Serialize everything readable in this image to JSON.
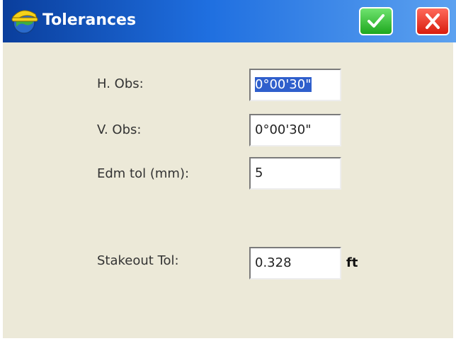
{
  "window": {
    "title": "Tolerances",
    "icon": "hard-hat-globe-icon",
    "ok_icon": "checkmark-icon",
    "cancel_icon": "close-x-icon"
  },
  "fields": {
    "h_obs": {
      "label": "H. Obs:",
      "value": "0°00'30\""
    },
    "v_obs": {
      "label": "V. Obs:",
      "value": "0°00'30\""
    },
    "edm_tol": {
      "label": "Edm tol (mm):",
      "value": "5"
    },
    "stakeout_tol": {
      "label": "Stakeout Tol:",
      "value": "0.328",
      "unit": "ft"
    }
  },
  "colors": {
    "titlebar_start": "#0a3e9c",
    "titlebar_end": "#5da2f0",
    "ok_button": "#2dbb2d",
    "cancel_button": "#e02a1a",
    "background": "#ece9d8",
    "selection": "#2f5fcc"
  }
}
